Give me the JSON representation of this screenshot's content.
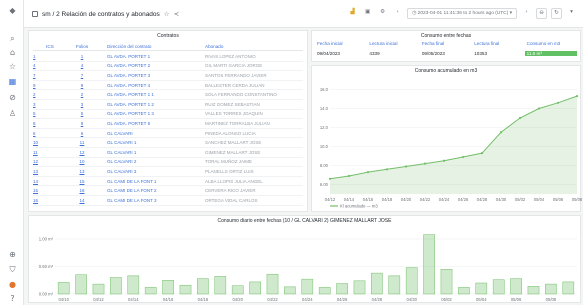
{
  "header": {
    "breadcrumb": "sm / 2 Relación de contratos y abonados",
    "time_range": "2023-04-01 11:41:36 to 2 hours ago (UTC)"
  },
  "icons": {
    "sidebar": [
      "search-icon",
      "home-icon",
      "star-icon",
      "dashboards-icon",
      "explore-icon",
      "alert-icon",
      "plus-icon",
      "shield-icon",
      "avatar",
      "help-icon"
    ],
    "toolbar": [
      "chart-add-icon",
      "save-icon",
      "settings-icon",
      "clock-icon",
      "zoom-out-icon",
      "refresh-icon",
      "chevron-down-icon"
    ]
  },
  "contratos": {
    "title": "Contratos",
    "columns": {
      "sel": "",
      "ics": "ICS",
      "folios": "Folios",
      "direccion": "Dirección del contrato",
      "abonado": "Abonado"
    },
    "rows": [
      {
        "sel": "1",
        "ics": "",
        "folio": "1",
        "direccion": "GL AVDA. PORTET 1",
        "abonado": "RIVAS LOPEZ ANTONIO"
      },
      {
        "sel": "4",
        "ics": "",
        "folio": "4",
        "direccion": "GL AVDA. PORTET 2",
        "abonado": "GIL MARTI GARCIA JORGE"
      },
      {
        "sel": "7",
        "ics": "",
        "folio": "7",
        "direccion": "GL AVDA. PORTET 3",
        "abonado": "SANTOS FERRANDO JAVIER"
      },
      {
        "sel": "9",
        "ics": "",
        "folio": "9",
        "direccion": "GL AVDA. PORTET 4",
        "abonado": "BALLESTER CERDA JULIAN"
      },
      {
        "sel": "2",
        "ics": "",
        "folio": "2",
        "direccion": "GL AVDA. PORTET 1 1",
        "abonado": "SOLA FERRANDO CONSTANTINO"
      },
      {
        "sel": "3",
        "ics": "",
        "folio": "3",
        "direccion": "GL AVDA. PORTET 1 2",
        "abonado": "RUIZ GOMEZ SEBASTIAN"
      },
      {
        "sel": "5",
        "ics": "",
        "folio": "5",
        "direccion": "GL AVDA. PORTET 1 3",
        "abonado": "VALLES TORRES JOAQUIN"
      },
      {
        "sel": "8",
        "ics": "",
        "folio": "8",
        "direccion": "GL AVDA. PORTET 5",
        "abonado": "MARTINEZ TORRALBA JULIAN"
      },
      {
        "sel": "6",
        "ics": "",
        "folio": "6",
        "direccion": "GL CALVARI",
        "abonado": "PINEDA ALONSO LUCIA"
      },
      {
        "sel": "10",
        "ics": "",
        "folio": "11",
        "direccion": "GL CALVARI 1",
        "abonado": "SANCHEZ MALLART JOSE"
      },
      {
        "sel": "11",
        "ics": "",
        "folio": "12",
        "direccion": "GL CALVARI 1",
        "abonado": "GIMENEZ MALLART JOSE"
      },
      {
        "sel": "12",
        "ics": "",
        "folio": "10",
        "direccion": "GL CALVARI 2",
        "abonado": "TORAL MUÑOZ JAIME"
      },
      {
        "sel": "13",
        "ics": "",
        "folio": "13",
        "direccion": "GL CALVARI 3",
        "abonado": "PLANELLS ORTIZ LUIS"
      },
      {
        "sel": "14",
        "ics": "",
        "folio": "15",
        "direccion": "GL CAMI DE LA FONT 1",
        "abonado": "ALBA LLOPIS JULIA ANGEL"
      },
      {
        "sel": "15",
        "ics": "",
        "folio": "16",
        "direccion": "GL CAMI DE LA FONT 2",
        "abonado": "CERVERA RICO JAVIER"
      },
      {
        "sel": "16",
        "ics": "",
        "folio": "14",
        "direccion": "GL CAMI DE LA FONT 3",
        "abonado": "ORTEGA VIDAL CARLOS"
      }
    ]
  },
  "consumo_fechas": {
    "title": "Consumo entre fechas",
    "headers": [
      "Fecha inicial",
      "Lectura inicial",
      "Fecha final",
      "Lectura final",
      "Consumo en m3"
    ],
    "values": [
      "09/04/2023",
      "4339",
      "09/05/2023",
      "10353",
      "11.6 m³"
    ],
    "highlight_color": "#62c064"
  },
  "line_chart": {
    "title": "Consumo acumulado en m3",
    "legend": "Kl acumulado  —  m3"
  },
  "bar_chart": {
    "title": "Consumo diario entre fechas (10 / GL CALVARI 2) GIMENEZ MALLART JOSE"
  },
  "chart_data": [
    {
      "type": "line",
      "title": "Consumo acumulado en m3",
      "x": [
        "04/12",
        "04/14",
        "04/16",
        "04/18",
        "04/20",
        "04/22",
        "04/24",
        "04/26",
        "04/28",
        "04/30",
        "05/02",
        "05/04",
        "05/06",
        "05/08"
      ],
      "series": [
        {
          "name": "Kl acumulado",
          "values": [
            6.6,
            6.9,
            7.3,
            7.6,
            7.9,
            8.2,
            8.5,
            8.9,
            9.3,
            11.5,
            13.0,
            14.0,
            14.6,
            15.3
          ]
        }
      ],
      "yticks": [
        "6.00",
        "8.00",
        "10.0",
        "12.0",
        "14.0",
        "16.0"
      ],
      "ylim": [
        5,
        17
      ],
      "color": "#73bf69"
    },
    {
      "type": "bar",
      "title": "Consumo diario entre fechas (10 / GL CALVARI 2) GIMENEZ MALLART JOSE",
      "categories": [
        "04/10",
        "04/11",
        "04/12",
        "04/13",
        "04/14",
        "04/15",
        "04/16",
        "04/17",
        "04/18",
        "04/19",
        "04/20",
        "04/21",
        "04/22",
        "04/23",
        "04/24",
        "04/25",
        "04/26",
        "04/27",
        "04/28",
        "04/29",
        "04/30",
        "05/01",
        "05/02",
        "05/03",
        "05/04",
        "05/05",
        "05/06",
        "05/07",
        "05/08",
        "05/09"
      ],
      "values": [
        0.21,
        0.35,
        0.18,
        0.3,
        0.33,
        0.12,
        0.25,
        0.16,
        0.28,
        0.32,
        0.15,
        0.22,
        0.36,
        0.13,
        0.27,
        0.12,
        0.19,
        0.24,
        0.38,
        0.33,
        0.48,
        1.08,
        0.45,
        0.12,
        0.2,
        0.26,
        0.28,
        0.14,
        0.18,
        0.22
      ],
      "xticks": [
        "04/10",
        "04/12",
        "04/14",
        "04/16",
        "04/18",
        "04/20",
        "04/22",
        "04/24",
        "04/26",
        "04/28",
        "04/30",
        "05/02",
        "05/04",
        "05/06",
        "05/08"
      ],
      "yticks": [
        "0.00 m³",
        "0.50 m³",
        "1.00 m³"
      ],
      "ylim": [
        0,
        1.2
      ],
      "color": "#73bf69"
    }
  ]
}
